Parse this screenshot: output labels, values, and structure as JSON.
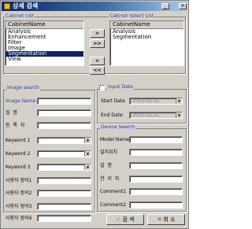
{
  "window": {
    "title": "상세 검색"
  },
  "cabinet_list": {
    "group_title": "Cabinet List",
    "column_header": "CabinetName",
    "items": [
      "Analysis",
      "Enhancement",
      "Filter",
      "Image",
      "Segmentation",
      "View"
    ],
    "selected_index": 4
  },
  "cabinet_select_list": {
    "group_title": "Cabinet Select List",
    "column_header": "CabinetName",
    "items": [
      "Analysis",
      "Segmentation"
    ]
  },
  "move_buttons": [
    ">",
    ">>",
    "<",
    "<<"
  ],
  "image_search": {
    "group_title": "Image search",
    "image_name_label": "Image Name",
    "desc_label": "설 명",
    "registrant_label": "등 록 자",
    "keywords": [
      {
        "label": "Keyword 1"
      },
      {
        "label": "Keyword 2"
      },
      {
        "label": "Keyword 3"
      }
    ],
    "user_defined": [
      "사용자 정의1",
      "사용자 정의2",
      "사용자 정의3",
      "사용자 정의4"
    ]
  },
  "input_date": {
    "checkbox_label": "Input Date",
    "start_label": "Start Date",
    "start_value": "2002-02-25",
    "end_label": "End Date",
    "end_value": "2002-02-25"
  },
  "device_search": {
    "group_title": "Device Search",
    "model_name_label": "Model Name",
    "location_label": "설치위치",
    "desc_label": "설 명",
    "manager_label": "관 리 자",
    "comment1_label": "Comment1",
    "comment2_label": "Comment2"
  },
  "buttons": {
    "search": "검 색",
    "cancel": "취 소"
  },
  "colors": {
    "face": "#d4d0c8",
    "accent": "#1c3ec9",
    "selection": "#0a246a"
  }
}
